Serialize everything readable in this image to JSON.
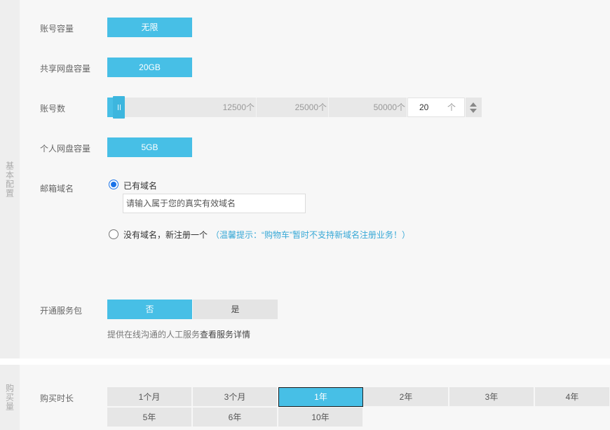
{
  "basic_section": {
    "side_label": "基本配置",
    "account_capacity": {
      "label": "账号容量",
      "value": "无限"
    },
    "shared_disk": {
      "label": "共享网盘容量",
      "value": "20GB"
    },
    "account_count": {
      "label": "账号数",
      "ticks": [
        "12500个",
        "25000个",
        "50000个"
      ],
      "value": "20",
      "unit": "个"
    },
    "personal_disk": {
      "label": "个人网盘容量",
      "value": "5GB"
    },
    "mail_domain": {
      "label": "邮箱域名",
      "option_have": "已有域名",
      "domain_placeholder": "请输入属于您的真实有效域名",
      "option_new": "没有域名，新注册一个",
      "hint": "（温馨提示：“购物车”暂时不支持新域名注册业务！）"
    },
    "service_pack": {
      "label": "开通服务包",
      "no": "否",
      "yes": "是",
      "note": "提供在线沟通的人工服务",
      "note_link": "查看服务详情"
    }
  },
  "buy_section": {
    "side_label": "购买量",
    "duration_label": "购买时长",
    "durations": [
      "1个月",
      "3个月",
      "1年",
      "2年",
      "3年",
      "4年",
      "5年",
      "6年",
      "10年"
    ],
    "selected_duration": "1年"
  },
  "colors": {
    "accent": "#47bfe6",
    "hint": "#37a8d6",
    "radio": "#1a73e8"
  }
}
